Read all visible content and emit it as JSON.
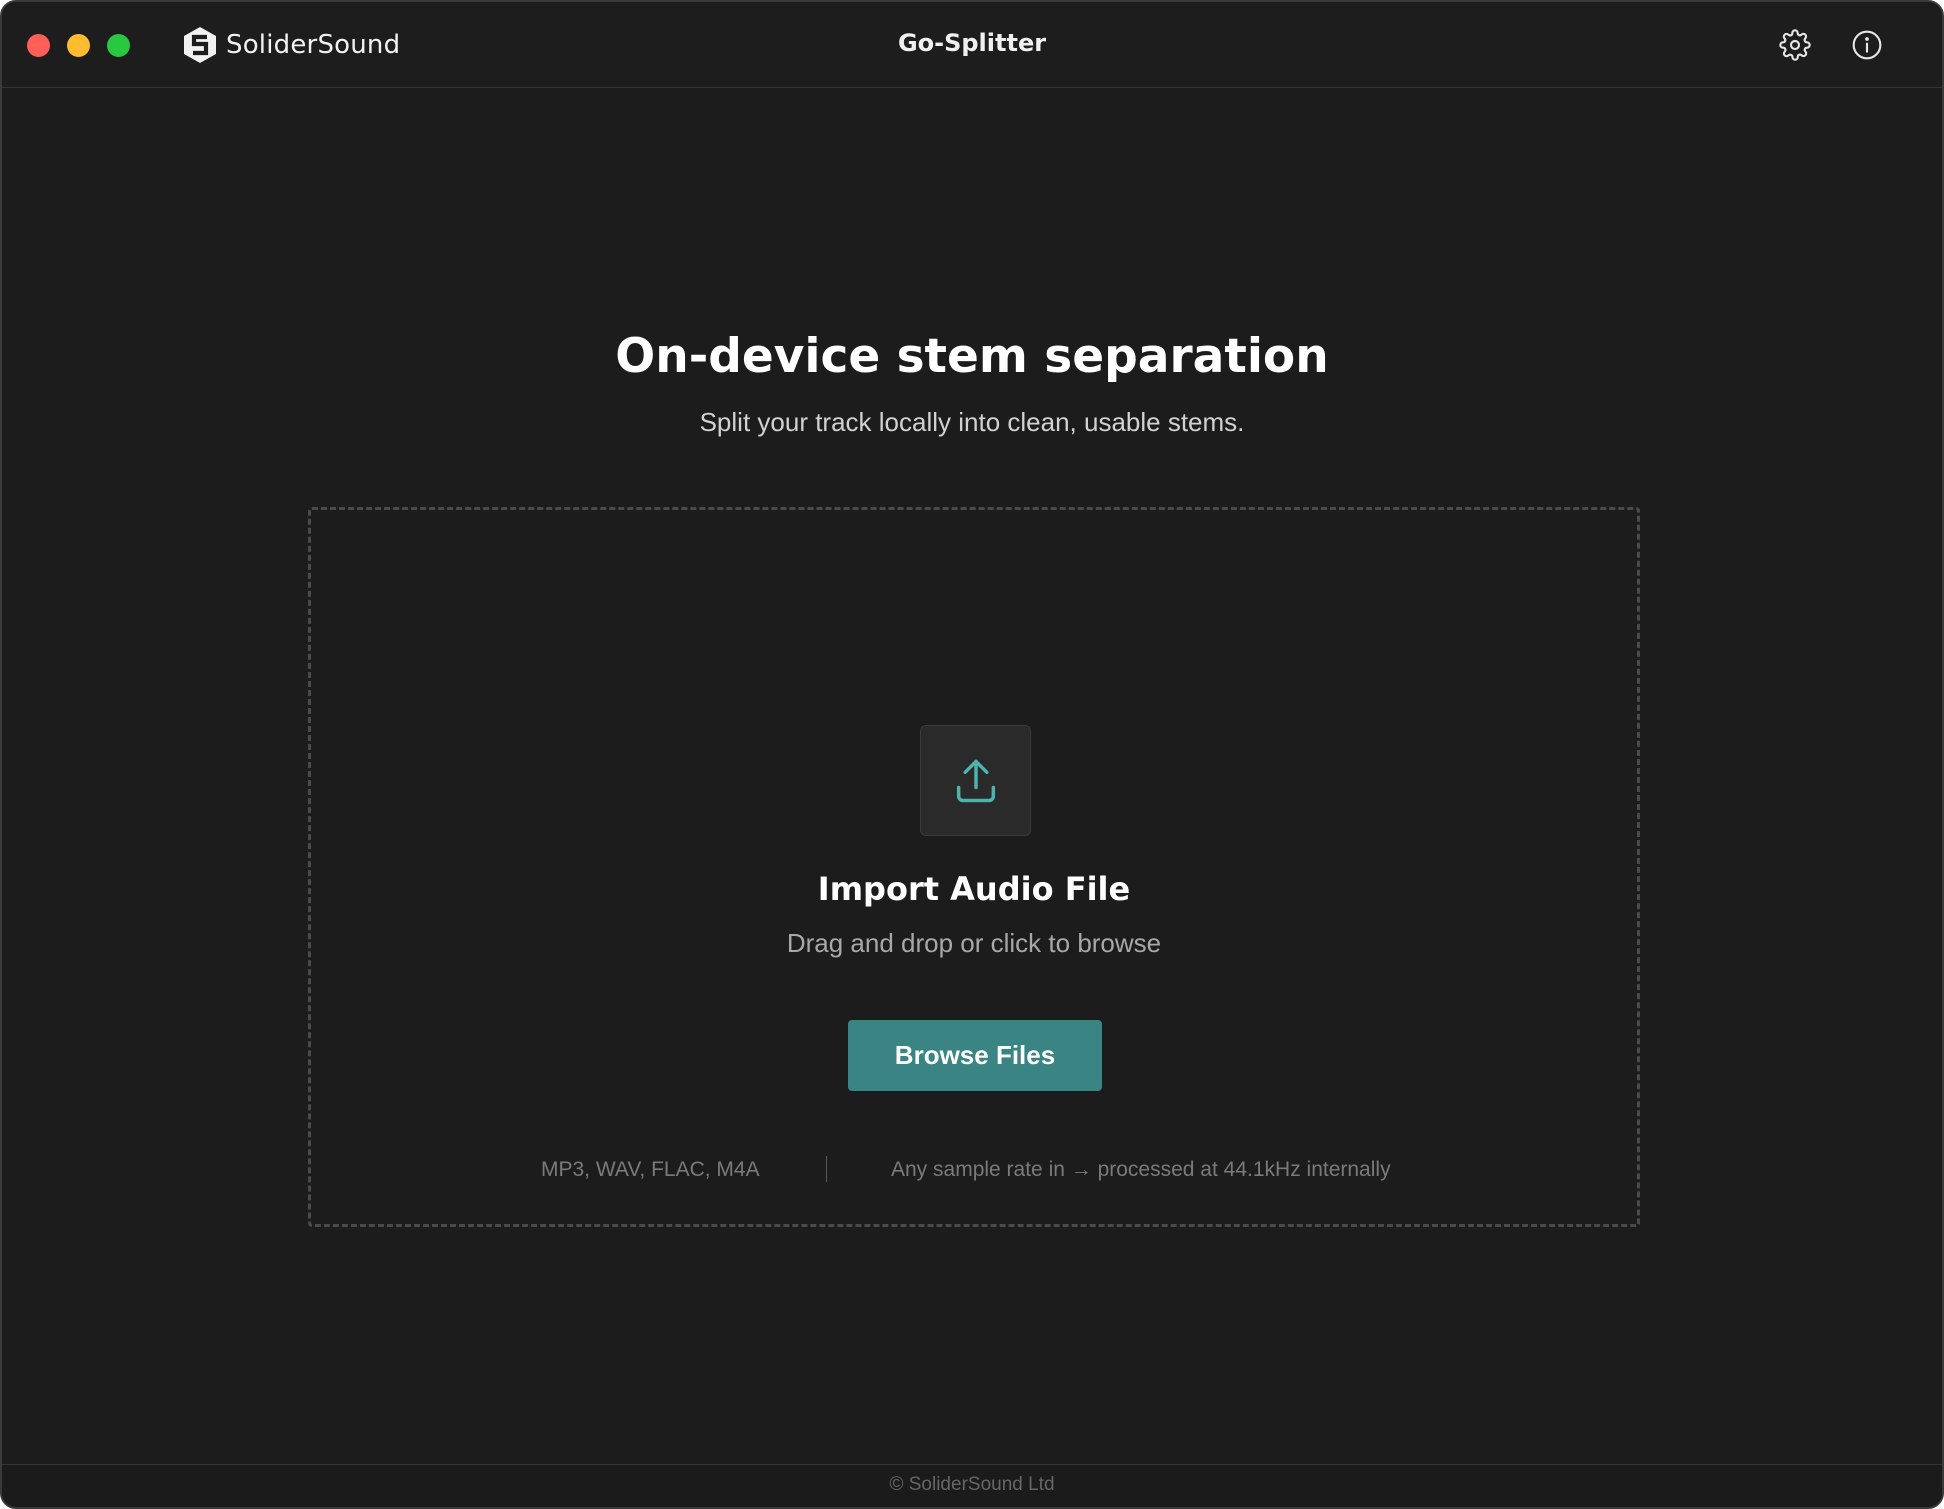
{
  "titlebar": {
    "brand_name": "SoliderSound",
    "window_title": "Go-Splitter",
    "icons": {
      "settings": "gear-icon",
      "info": "info-icon",
      "logo": "soldersound-logo-icon"
    }
  },
  "hero": {
    "title": "On-device stem separation",
    "subtitle": "Split your track locally into clean, usable stems."
  },
  "dropzone": {
    "icon": "upload-icon",
    "title": "Import Audio File",
    "hint": "Drag and drop or click to browse",
    "browse_label": "Browse Files",
    "formats": "MP3, WAV, FLAC, M4A",
    "rate_note": "Any sample rate in → processed at 44.1kHz internally"
  },
  "footer": {
    "copyright": "© SoliderSound Ltd"
  },
  "colors": {
    "background": "#1c1c1c",
    "accent": "#3a8484",
    "upload_icon": "#4fb3ad",
    "close": "#ff5f57",
    "minimize": "#febc2e",
    "maximize": "#28c840"
  }
}
